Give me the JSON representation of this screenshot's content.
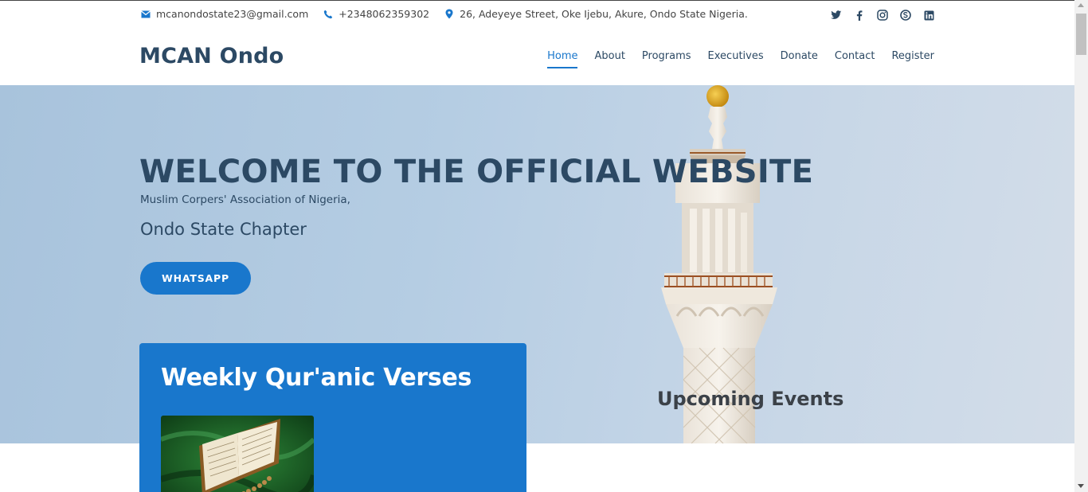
{
  "topbar": {
    "email": "mcanondostate23@gmail.com",
    "phone": "+2348062359302",
    "address": "26, Adeyeye Street, Oke Ijebu, Akure, Ondo State Nigeria.",
    "social_icons": [
      "twitter-icon",
      "facebook-icon",
      "instagram-icon",
      "skype-icon",
      "linkedin-icon"
    ]
  },
  "header": {
    "logo": "MCAN Ondo",
    "nav": [
      "Home",
      "About",
      "Programs",
      "Executives",
      "Donate",
      "Contact",
      "Register"
    ],
    "active_nav": "Home"
  },
  "hero": {
    "title": "WELCOME TO THE OFFICIAL WEBSITE",
    "subtitle": "Muslim Corpers' Association of Nigeria,",
    "chapter": "Ondo State Chapter",
    "button": "WHATSAPP",
    "events_heading": "Upcoming Events"
  },
  "card": {
    "title": "Weekly Qur'anic Verses"
  },
  "colors": {
    "accent": "#1977cc",
    "heading": "#2c4964"
  }
}
